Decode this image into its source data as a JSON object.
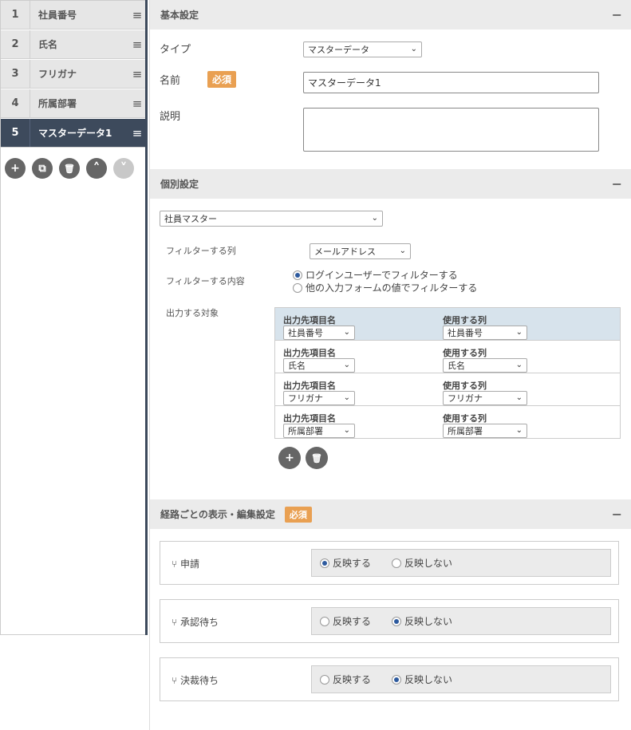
{
  "fields": [
    {
      "num": "1",
      "label": "社員番号"
    },
    {
      "num": "2",
      "label": "氏名"
    },
    {
      "num": "3",
      "label": "フリガナ"
    },
    {
      "num": "4",
      "label": "所属部署"
    },
    {
      "num": "5",
      "label": "マスターデータ1"
    }
  ],
  "field_handle_icon": "≡",
  "tools": {
    "add": "+",
    "copy": "⧉",
    "delete": "🗑",
    "up": "˄",
    "down": "˅"
  },
  "basic": {
    "title": "基本設定",
    "collapse": "−",
    "type_label": "タイプ",
    "type_value": "マスターデータ",
    "name_label": "名前",
    "required": "必須",
    "name_value": "マスターデータ1",
    "desc_label": "説明"
  },
  "individual": {
    "title": "個別設定",
    "collapse": "−",
    "master_value": "社員マスター",
    "filter_col_label": "フィルターする列",
    "filter_col_value": "メールアドレス",
    "filter_content_label": "フィルターする内容",
    "filter_opt1": "ログインユーザーでフィルターする",
    "filter_opt2": "他の入力フォームの値でフィルターする",
    "output_label": "出力する対象",
    "out_head_left": "出力先項目名",
    "out_head_right": "使用する列",
    "outputs": [
      {
        "dest": "社員番号",
        "col": "社員番号"
      },
      {
        "dest": "氏名",
        "col": "氏名"
      },
      {
        "dest": "フリガナ",
        "col": "フリガナ"
      },
      {
        "dest": "所属部署",
        "col": "所属部署"
      }
    ]
  },
  "route": {
    "title": "経路ごとの表示・編集設定",
    "required": "必須",
    "collapse": "−",
    "opt_on": "反映する",
    "opt_off": "反映しない",
    "items": [
      {
        "name": "申請",
        "on": true
      },
      {
        "name": "承認待ち",
        "on": false
      },
      {
        "name": "決裁待ち",
        "on": false
      }
    ]
  }
}
